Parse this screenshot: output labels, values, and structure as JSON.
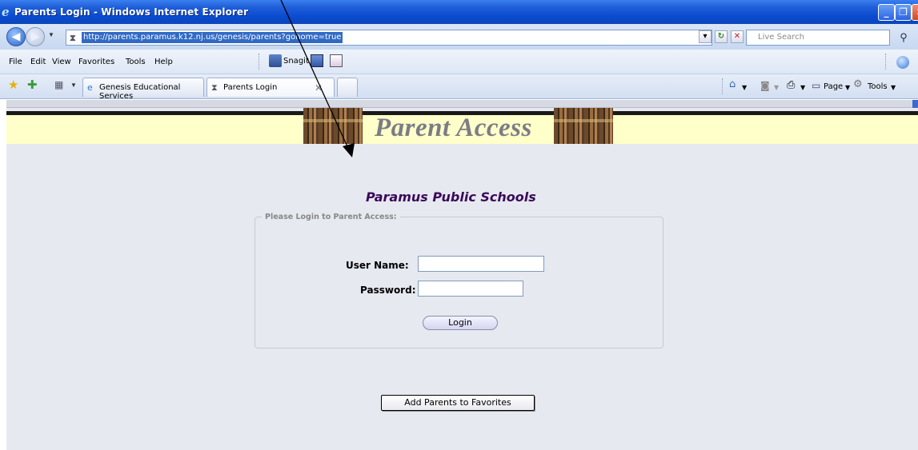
{
  "window": {
    "title": "Parents Login - Windows Internet Explorer"
  },
  "address_bar": {
    "url": "http://parents.paramus.k12.nj.us/genesis/parents?gohome=true",
    "search_placeholder": "Live Search"
  },
  "menu": {
    "items": [
      "File",
      "Edit",
      "View",
      "Favorites",
      "Tools",
      "Help"
    ],
    "snagit_label": "Snagit"
  },
  "tabs": [
    {
      "label": "Genesis Educational Services"
    },
    {
      "label": "Parents Login"
    }
  ],
  "command_bar": {
    "page_label": "Page",
    "tools_label": "Tools"
  },
  "page": {
    "banner_title": "Parent Access",
    "school_name": "Paramus Public Schools",
    "login_legend": "Please Login to Parent Access:",
    "username_label": "User Name:",
    "username_value": "",
    "password_label": "Password:",
    "password_value": "",
    "login_button": "Login",
    "favorites_button": "Add Parents to Favorites"
  },
  "colors": {
    "titlebar": "#0a4ad0",
    "banner_bg": "#ffffc9",
    "school_name": "#3a0a5a",
    "page_bg": "#e7e9f0"
  }
}
